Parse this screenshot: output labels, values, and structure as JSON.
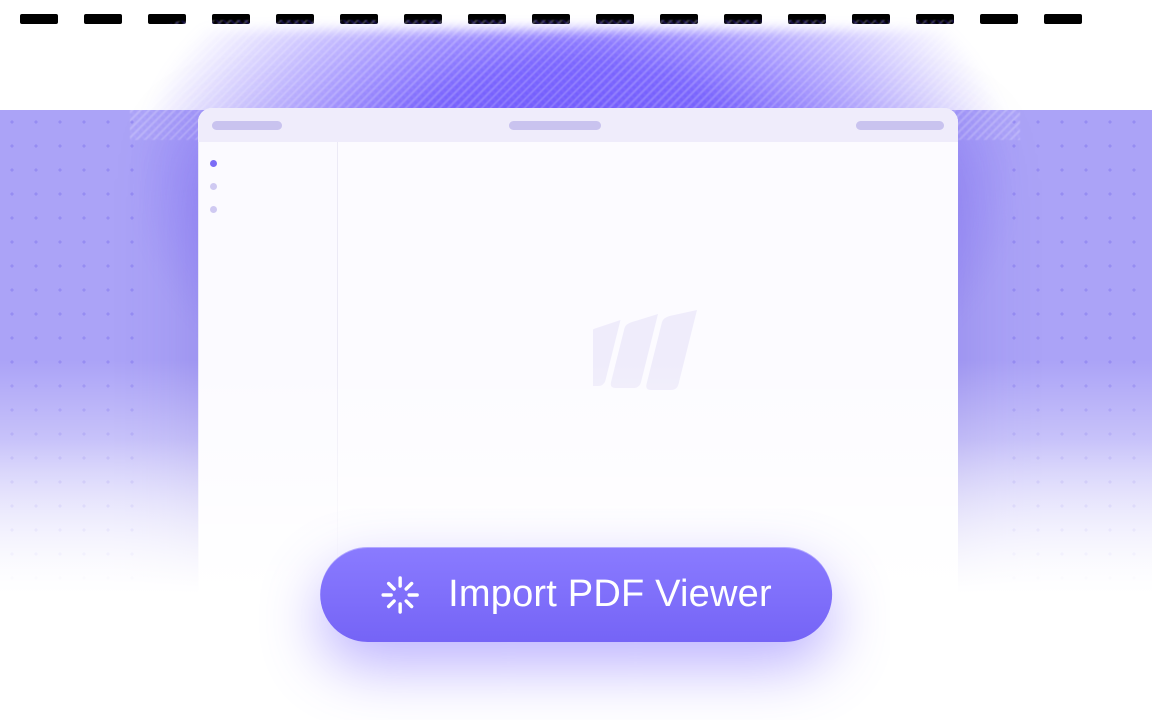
{
  "cta": {
    "label": "Import PDF Viewer",
    "icon": "spinner-icon"
  },
  "colors": {
    "accent": "#7564f6",
    "glow": "#6a54ff",
    "panel": "#aba3f7"
  }
}
